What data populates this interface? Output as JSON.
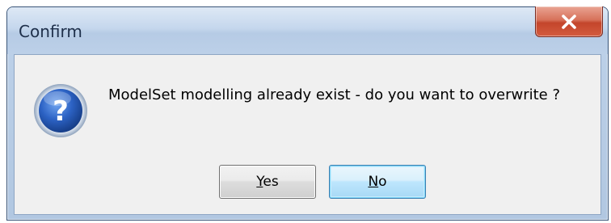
{
  "dialog": {
    "title": "Confirm",
    "message": "ModelSet modelling already exist - do you want to overwrite ?",
    "icon": "question-icon",
    "close_icon": "close-icon",
    "buttons": [
      {
        "label_mnemonic": "Y",
        "label_rest": "es",
        "default": false
      },
      {
        "label_mnemonic": "N",
        "label_rest": "o",
        "default": true
      }
    ]
  },
  "colors": {
    "title_text": "#1e2f4a",
    "close_button": "#c4452b",
    "default_button_border": "#3c7fb1",
    "icon_blue": "#1f4fa6"
  }
}
